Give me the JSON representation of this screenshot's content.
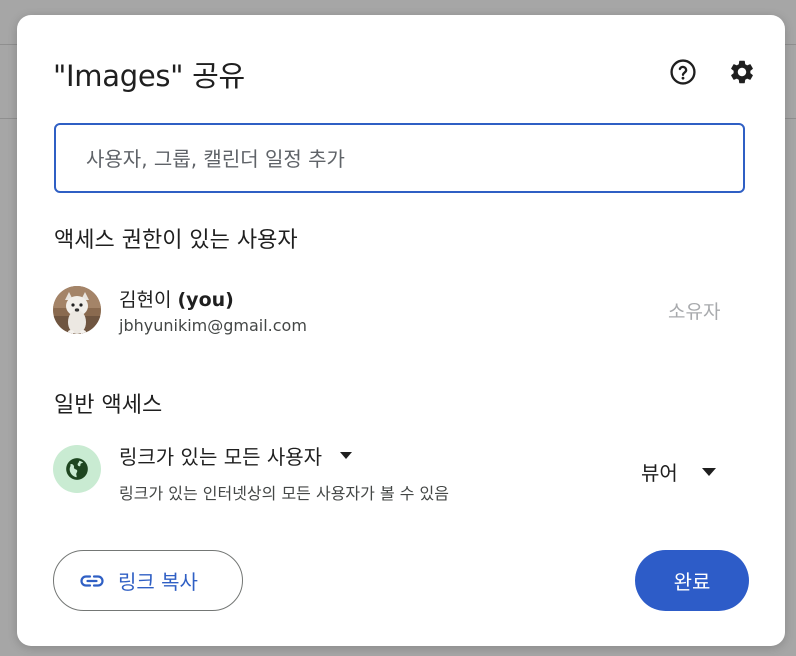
{
  "dialog": {
    "title": "\"Images\" 공유",
    "help_icon": "help-circle-icon",
    "settings_icon": "gear-icon"
  },
  "add_people": {
    "value": "",
    "placeholder": "사용자, 그룹, 캘린더 일정 추가"
  },
  "people_with_access": {
    "heading": "액세스 권한이 있는 사용자",
    "users": [
      {
        "name": "김현이",
        "you_label": "(you)",
        "email": "jbhyunikim@gmail.com",
        "role": "소유자",
        "avatar_icon": "dog-avatar"
      }
    ]
  },
  "general_access": {
    "heading": "일반 액세스",
    "icon": "globe-icon",
    "link_setting": "링크가 있는 모든 사용자",
    "description": "링크가 있는 인터넷상의 모든 사용자가 볼 수 있음",
    "role": "뷰어"
  },
  "footer": {
    "copy_link_label": "링크 복사",
    "copy_link_icon": "link-icon",
    "done_label": "완료"
  },
  "colors": {
    "accent": "#2d5cc8",
    "globe_bg": "#c9ebd2",
    "globe_fg": "#1e4620"
  }
}
